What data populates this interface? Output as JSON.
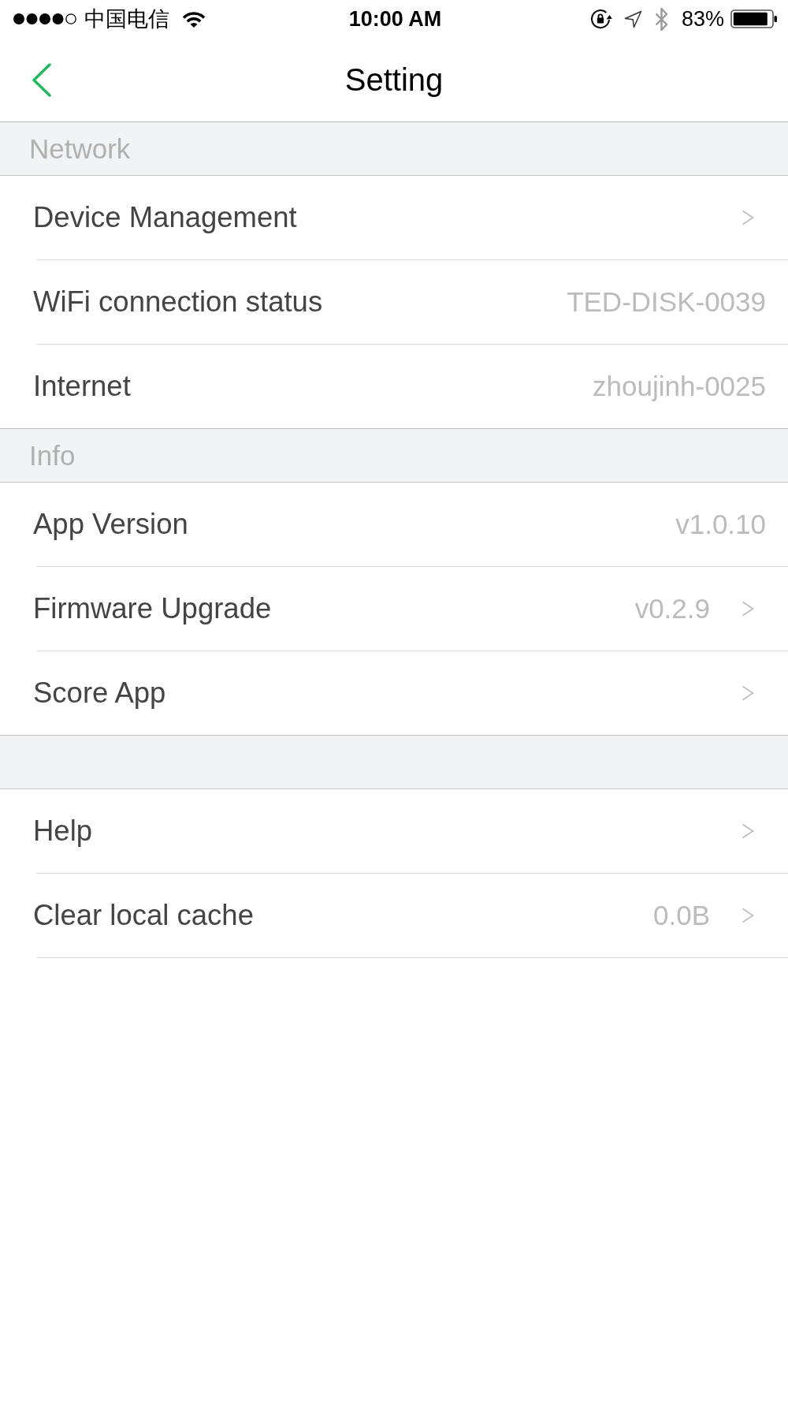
{
  "status_bar": {
    "carrier": "中国电信",
    "time": "10:00 AM",
    "battery": "83%"
  },
  "nav_bar": {
    "title": "Setting"
  },
  "sections": [
    {
      "title": "Network",
      "rows": [
        {
          "label": "Device Management",
          "chevron": true
        },
        {
          "label": "WiFi connection status",
          "value": "TED-DISK-0039",
          "chevron": false
        },
        {
          "label": "Internet",
          "value": "zhoujinh-0025",
          "chevron": false
        }
      ]
    },
    {
      "title": "Info",
      "rows": [
        {
          "label": "App Version",
          "value": "v1.0.10",
          "chevron": false
        },
        {
          "label": "Firmware Upgrade",
          "value": "v0.2.9",
          "chevron": true
        },
        {
          "label": "Score App",
          "chevron": true
        }
      ]
    },
    {
      "rows": [
        {
          "label": "Help",
          "chevron": true
        },
        {
          "label": "Clear local cache",
          "value": "0.0B",
          "chevron": true
        }
      ]
    }
  ]
}
